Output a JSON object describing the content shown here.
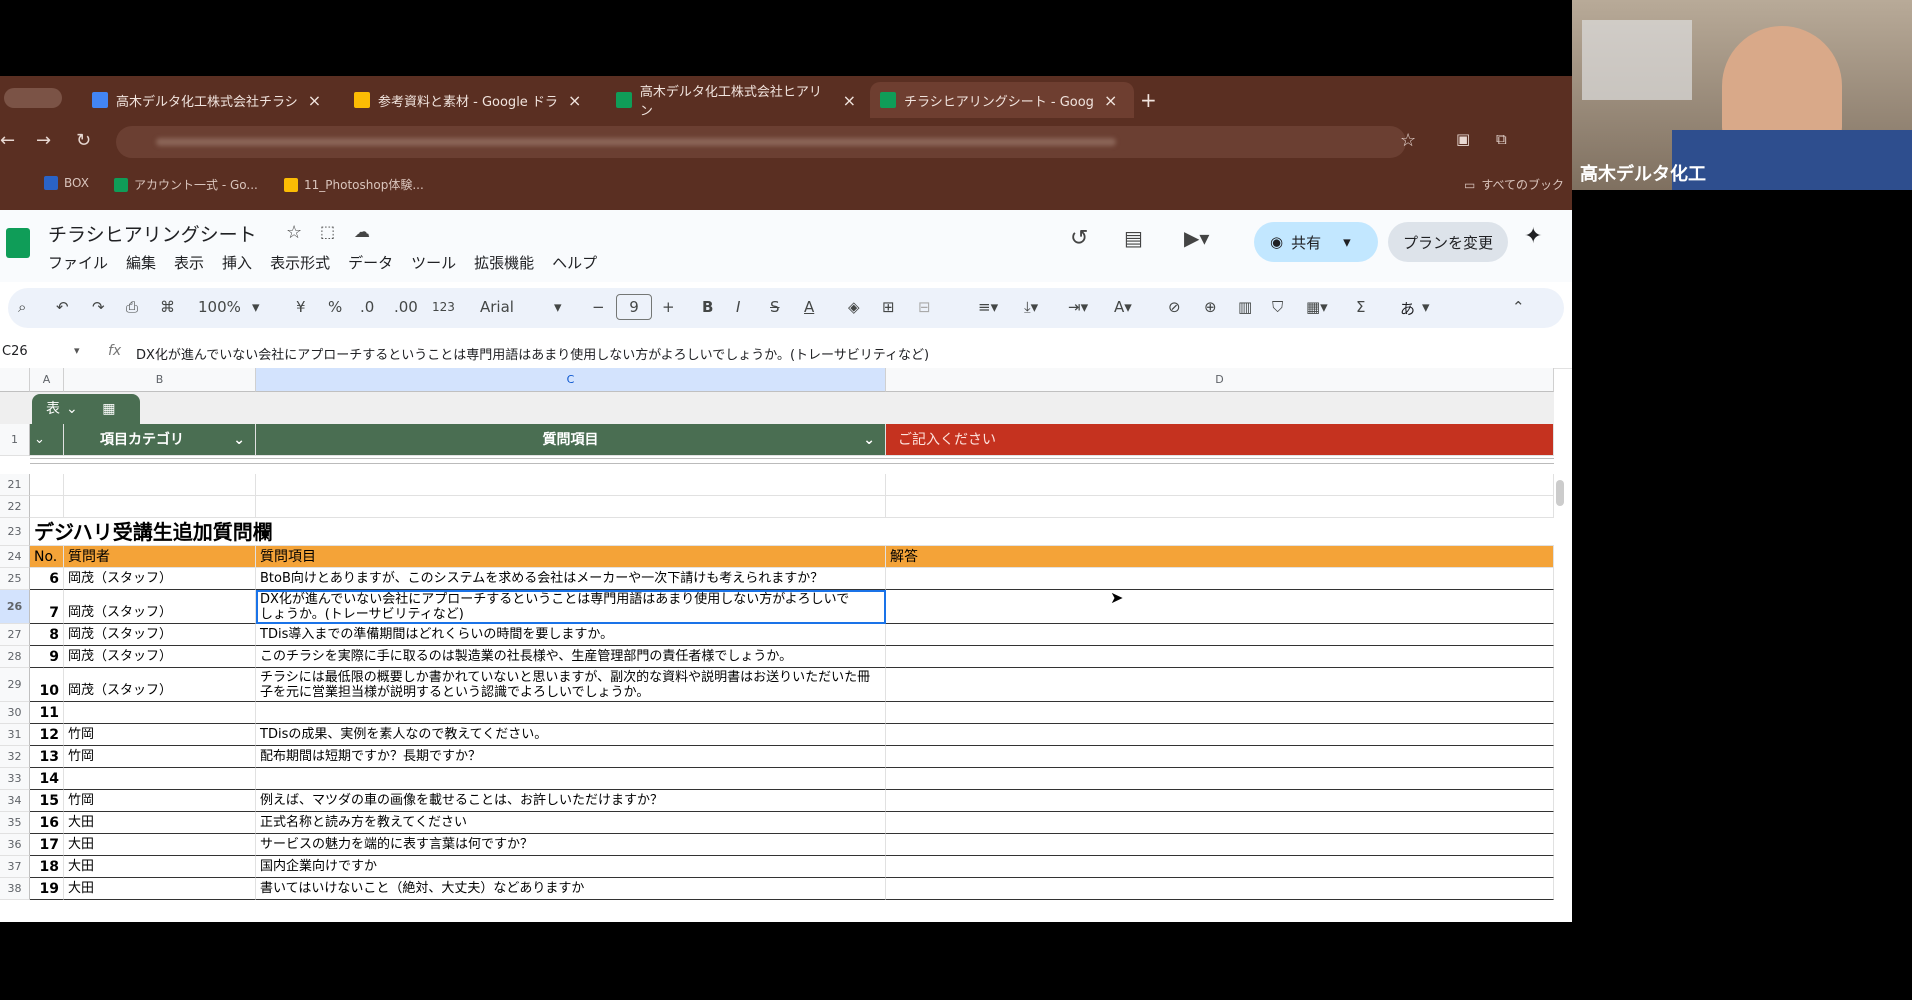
{
  "browser": {
    "tabs": [
      {
        "label": "高木デルタ化工株式会社チラシ",
        "color": "#4285f4"
      },
      {
        "label": "参考資料と素材 - Google ドラ",
        "color": "#fbbc04"
      },
      {
        "label": "高木デルタ化工株式会社ヒアリン",
        "color": "#0f9d58"
      },
      {
        "label": "チラシヒアリングシート - Goog",
        "color": "#0f9d58"
      }
    ],
    "add_tab": "+",
    "bookmarks": [
      "BOX",
      "アカウント一式 - Go...",
      "11_Photoshop体験..."
    ],
    "all_bookmarks": "すべてのブック"
  },
  "sheet": {
    "title": "チラシヒアリングシート",
    "menus": [
      "ファイル",
      "編集",
      "表示",
      "挿入",
      "表示形式",
      "データ",
      "ツール",
      "拡張機能",
      "ヘルプ"
    ],
    "share_label": "共有",
    "plan_label": "プランを変更",
    "toolbar": {
      "zoom": "100%",
      "currency": "¥",
      "percent": "%",
      "dec_less": ".0",
      "dec_more": ".00",
      "format123": "123",
      "font": "Arial",
      "font_size": "9",
      "ime": "あ"
    },
    "cell_ref": "C26",
    "formula_fx": "fx",
    "formula": "DX化が進んでいない会社にアプローチするということは専門用語はあまり使用しない方がよろしいでしょうか。(トレーサビリティなど)",
    "columns": [
      "A",
      "B",
      "C",
      "D"
    ],
    "table_chip": "表",
    "header_row": {
      "num": "1",
      "category": "項目カテゴリ",
      "question": "質問項目",
      "answer": "ご記入ください"
    },
    "section_title": "デジハリ受講生追加質問欄",
    "table_headers": {
      "no": "No.",
      "asker": "質問者",
      "question": "質問項目",
      "answer": "解答"
    },
    "rows": [
      {
        "r": "21",
        "no": "",
        "asker": "",
        "q": "",
        "q2": ""
      },
      {
        "r": "22",
        "no": "",
        "asker": "",
        "q": "",
        "q2": ""
      },
      {
        "r": "23",
        "no": "",
        "asker": "",
        "q": "",
        "q2": ""
      },
      {
        "r": "24",
        "no": "",
        "asker": "",
        "q": "",
        "q2": ""
      },
      {
        "r": "25",
        "no": "6",
        "asker": "岡茂（スタッフ）",
        "q": "BtoB向けとありますが、このシステムを求める会社はメーカーや一次下請けも考えられますか？",
        "q2": ""
      },
      {
        "r": "26",
        "no": "7",
        "asker": "岡茂（スタッフ）",
        "q": "DX化が進んでいない会社にアプローチするということは専門用語はあまり使用しない方がよろしいで",
        "q2": "しょうか。(トレーサビリティなど)"
      },
      {
        "r": "27",
        "no": "8",
        "asker": "岡茂（スタッフ）",
        "q": "TDis導入までの準備期間はどれくらいの時間を要しますか。",
        "q2": ""
      },
      {
        "r": "28",
        "no": "9",
        "asker": "岡茂（スタッフ）",
        "q": "このチラシを実際に手に取るのは製造業の社長様や、生産管理部門の責任者様でしょうか。",
        "q2": ""
      },
      {
        "r": "29",
        "no": "10",
        "asker": "岡茂（スタッフ）",
        "q": "チラシには最低限の概要しか書かれていないと思いますが、副次的な資料や説明書はお送りいただいた冊",
        "q2": "子を元に営業担当様が説明するという認識でよろしいでしょうか。"
      },
      {
        "r": "30",
        "no": "11",
        "asker": "",
        "q": "",
        "q2": ""
      },
      {
        "r": "31",
        "no": "12",
        "asker": "竹岡",
        "q": "TDisの成果、実例を素人なので教えてください。",
        "q2": ""
      },
      {
        "r": "32",
        "no": "13",
        "asker": "竹岡",
        "q": "配布期間は短期ですか？長期ですか？",
        "q2": ""
      },
      {
        "r": "33",
        "no": "14",
        "asker": "",
        "q": "",
        "q2": ""
      },
      {
        "r": "34",
        "no": "15",
        "asker": "竹岡",
        "q": "例えば、マツダの車の画像を載せることは、お許しいただけますか？",
        "q2": ""
      },
      {
        "r": "35",
        "no": "16",
        "asker": "大田",
        "q": "正式名称と読み方を教えてください",
        "q2": ""
      },
      {
        "r": "36",
        "no": "17",
        "asker": "大田",
        "q": "サービスの魅力を端的に表す言葉は何ですか？",
        "q2": ""
      },
      {
        "r": "37",
        "no": "18",
        "asker": "大田",
        "q": "国内企業向けですか",
        "q2": ""
      },
      {
        "r": "38",
        "no": "19",
        "asker": "大田",
        "q": "書いてはいけないこと（絶対、大丈夫）などありますか",
        "q2": ""
      }
    ]
  },
  "webcam": {
    "name": "高木デルタ化工"
  },
  "colors": {
    "green_header": "#4a6e52",
    "red_header": "#c5321f",
    "orange_header": "#f4a338",
    "chrome": "#5a2f22"
  }
}
